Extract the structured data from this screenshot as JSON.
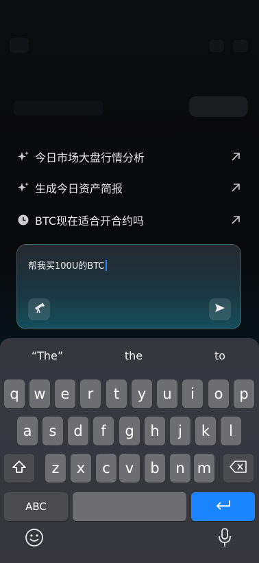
{
  "suggestions": [
    {
      "label": "今日市场大盘行情分析",
      "icon": "sparkle-icon"
    },
    {
      "label": "生成今日资产简报",
      "icon": "sparkle-icon"
    },
    {
      "label": "BTC现在适合开合约吗",
      "icon": "clock-icon"
    }
  ],
  "composer": {
    "text": "帮我买100U的BTC"
  },
  "keyboard": {
    "predictions": [
      "“The”",
      "the",
      "to"
    ],
    "row1": [
      "q",
      "w",
      "e",
      "r",
      "t",
      "y",
      "u",
      "i",
      "o",
      "p"
    ],
    "row2": [
      "a",
      "s",
      "d",
      "f",
      "g",
      "h",
      "j",
      "k",
      "l"
    ],
    "row3": [
      "z",
      "x",
      "c",
      "v",
      "b",
      "n",
      "m"
    ],
    "abc_label": "ABC"
  },
  "colors": {
    "accent": "#1a84ff",
    "key": "#6d6d72",
    "key_dark": "#4a4a4f"
  }
}
